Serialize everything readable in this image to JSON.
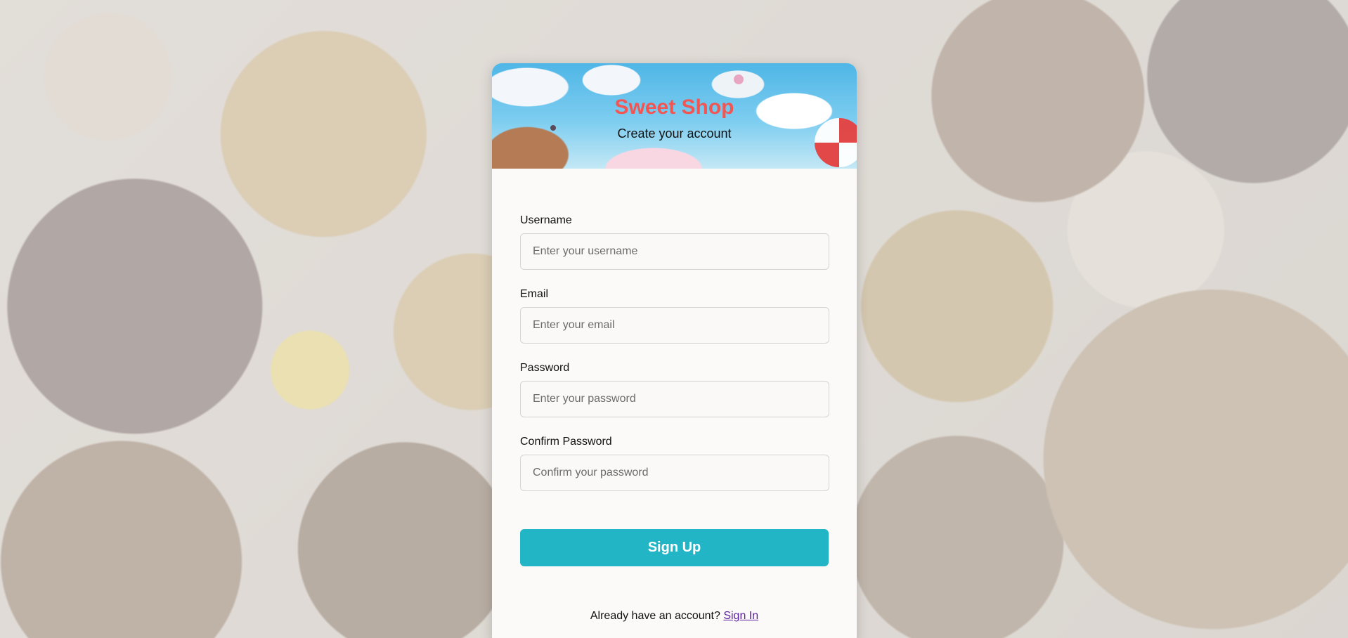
{
  "brand": {
    "title": "Sweet Shop",
    "subtitle": "Create your account",
    "title_color": "#f25552"
  },
  "form": {
    "fields": [
      {
        "label": "Username",
        "placeholder": "Enter your username",
        "value": ""
      },
      {
        "label": "Email",
        "placeholder": "Enter your email",
        "value": ""
      },
      {
        "label": "Password",
        "placeholder": "Enter your password",
        "value": ""
      },
      {
        "label": "Confirm Password",
        "placeholder": "Confirm your password",
        "value": ""
      }
    ],
    "submit_label": "Sign Up",
    "submit_color": "#22b5c6"
  },
  "footer": {
    "prompt": "Already have an account?",
    "link_label": "Sign In"
  }
}
